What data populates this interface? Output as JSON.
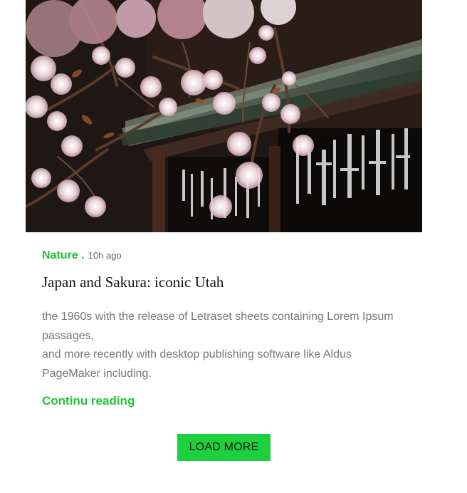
{
  "article": {
    "image_alt": "Cherry blossoms in front of a Japanese temple",
    "category": "Nature .",
    "time": "10h ago",
    "title": "Japan and Sakura: iconic Utah",
    "excerpt_line1": "the 1960s with the release of Letraset sheets containing Lorem Ipsum passages,",
    "excerpt_line2": "and more recently with desktop publishing software like Aldus PageMaker including.",
    "continue_label": "Continu reading"
  },
  "actions": {
    "load_more_label": "LOAD MORE"
  },
  "colors": {
    "accent": "#20c33a",
    "button": "#1ed03d"
  }
}
